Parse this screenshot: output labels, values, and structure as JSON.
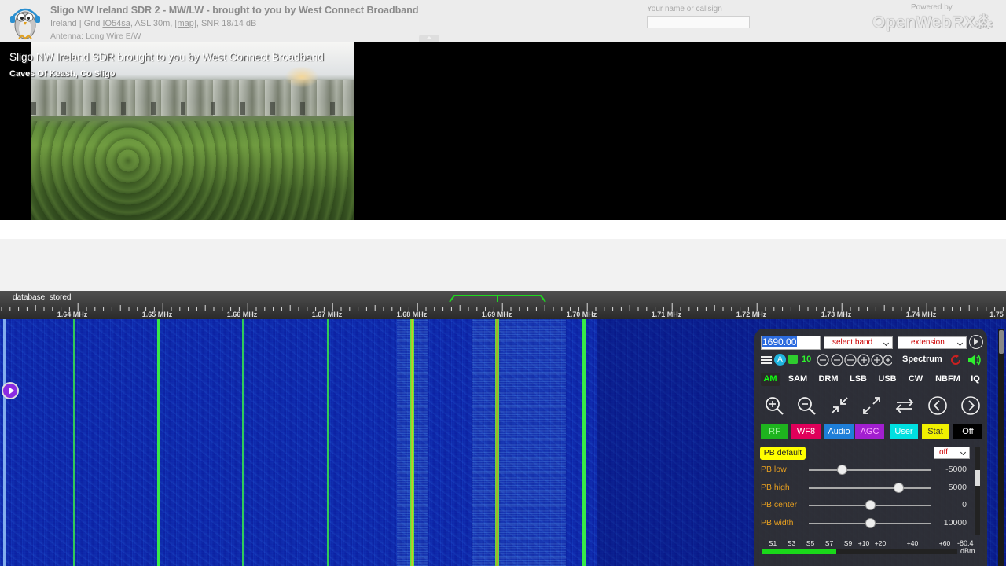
{
  "header": {
    "title": "Sligo NW Ireland SDR 2 - MW/LW - brought to you by West Connect Broadband",
    "location_prefix": "Ireland | Grid",
    "grid": "IO54sa",
    "asl": ", ASL 30m,",
    "map_link": "[map]",
    "snr": ", SNR 18/14 dB",
    "antenna": "Antenna: Long Wire E/W",
    "callsign_label": "Your name or callsign",
    "callsign_value": "",
    "powered_by": "Powered by",
    "brand": "OpenWebRX"
  },
  "banner": {
    "title": "Sligo NW Ireland SDR brought to you by West Connect Broadband",
    "subtitle": "Caves Of Keash, Co Sligo"
  },
  "scale": {
    "database_status": "database: stored",
    "labels": [
      "1.64 MHz",
      "1.65 MHz",
      "1.66 MHz",
      "1.67 MHz",
      "1.68 MHz",
      "1.69 MHz",
      "1.70 MHz",
      "1.71 MHz",
      "1.72 MHz",
      "1.73 MHz",
      "1.74 MHz",
      "1.75"
    ]
  },
  "controls": {
    "frequency": "1690.00",
    "band_select": "select band",
    "extension_select": "extension",
    "step": "10",
    "spectrum_label": "Spectrum",
    "modes": [
      "AM",
      "SAM",
      "DRM",
      "LSB",
      "USB",
      "CW",
      "NBFM",
      "IQ"
    ],
    "active_mode": "AM",
    "display_buttons": [
      {
        "label": "RF",
        "color": "#1eb41e",
        "text_color": "#9ff09f"
      },
      {
        "label": "WF8",
        "color": "#e0005a",
        "text_color": "#ffffff"
      },
      {
        "label": "Audio",
        "color": "#1f7fd8",
        "text_color": "#ffffff"
      },
      {
        "label": "AGC",
        "color": "#a21fd0",
        "text_color": "#ffb0ff"
      },
      {
        "label": "User",
        "color": "#00e0e0",
        "text_color": "#ffffff"
      },
      {
        "label": "Stat",
        "color": "#f0f000",
        "text_color": "#333333"
      },
      {
        "label": "Off",
        "color": "#000000",
        "text_color": "#ffffff"
      }
    ],
    "pb_default": "PB default",
    "pb_mode": "off",
    "sliders": [
      {
        "label": "PB low",
        "value": "-5000",
        "fraction": 0.27
      },
      {
        "label": "PB high",
        "value": "5000",
        "fraction": 0.73
      },
      {
        "label": "PB center",
        "value": "0",
        "fraction": 0.5
      },
      {
        "label": "PB width",
        "value": "10000",
        "fraction": 0.5
      }
    ],
    "smeter": {
      "labels": [
        "S1",
        "S3",
        "S5",
        "S7",
        "S9",
        "+10",
        "+20",
        "+40",
        "+60"
      ],
      "peak": "-80.4",
      "unit": "dBm",
      "level_fraction": 0.38
    }
  },
  "colors": {
    "waterfall_base": "#0a1a9a",
    "signal_green": "#3cff3c",
    "passband_marker": "#1ed81e",
    "accent_red": "#cc0000"
  }
}
